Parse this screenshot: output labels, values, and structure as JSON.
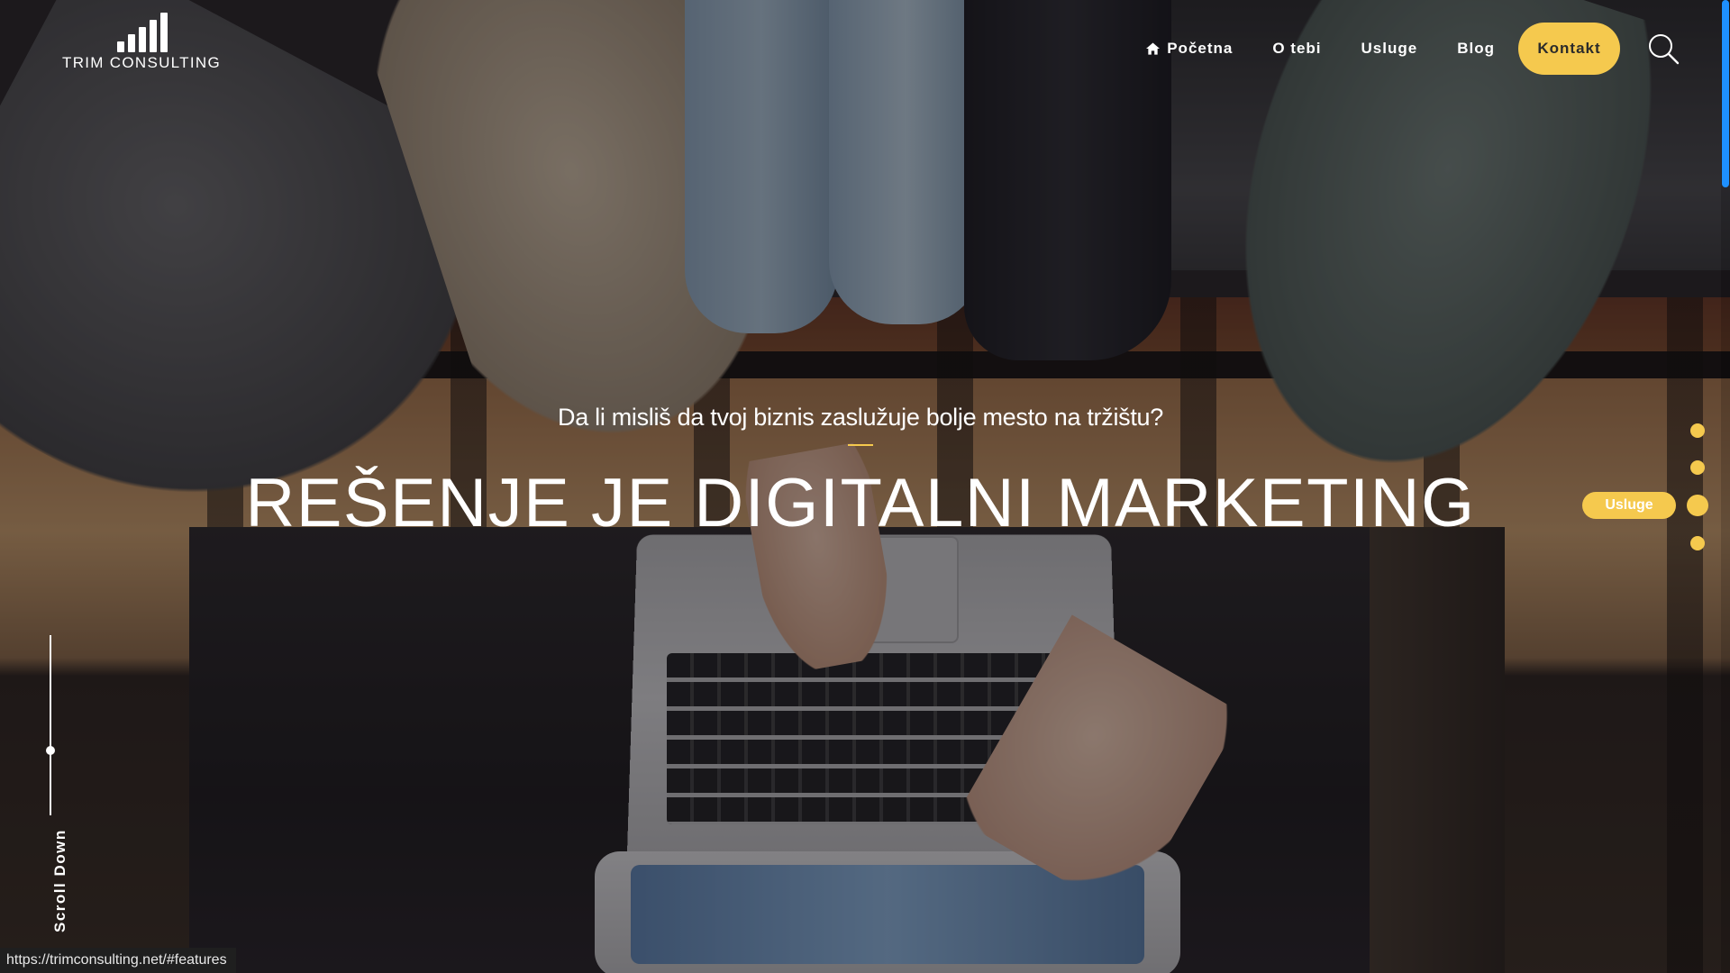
{
  "logo": {
    "text": "TRIM CONSULTING",
    "icon": "bar-chart-logo"
  },
  "nav": {
    "items": [
      {
        "label": "Početna",
        "icon": "home-icon"
      },
      {
        "label": "O tebi"
      },
      {
        "label": "Usluge"
      },
      {
        "label": "Blog"
      }
    ],
    "cta_label": "Kontakt",
    "search_icon": "search-icon"
  },
  "hero": {
    "subtitle": "Da li misliš da tvoj biznis zaslužuje bolje mesto na tržištu?",
    "title": "REŠENJE JE DIGITALNI MARKETING"
  },
  "section_nav": {
    "active_label": "Usluge",
    "dot_count": 4,
    "active_index": 2
  },
  "scroll": {
    "label": "Scroll Down"
  },
  "status_bar": {
    "url": "https://trimconsulting.net/#features"
  },
  "colors": {
    "accent": "#f5c94e",
    "text": "#ffffff",
    "status_bg": "#1f1f1f"
  }
}
